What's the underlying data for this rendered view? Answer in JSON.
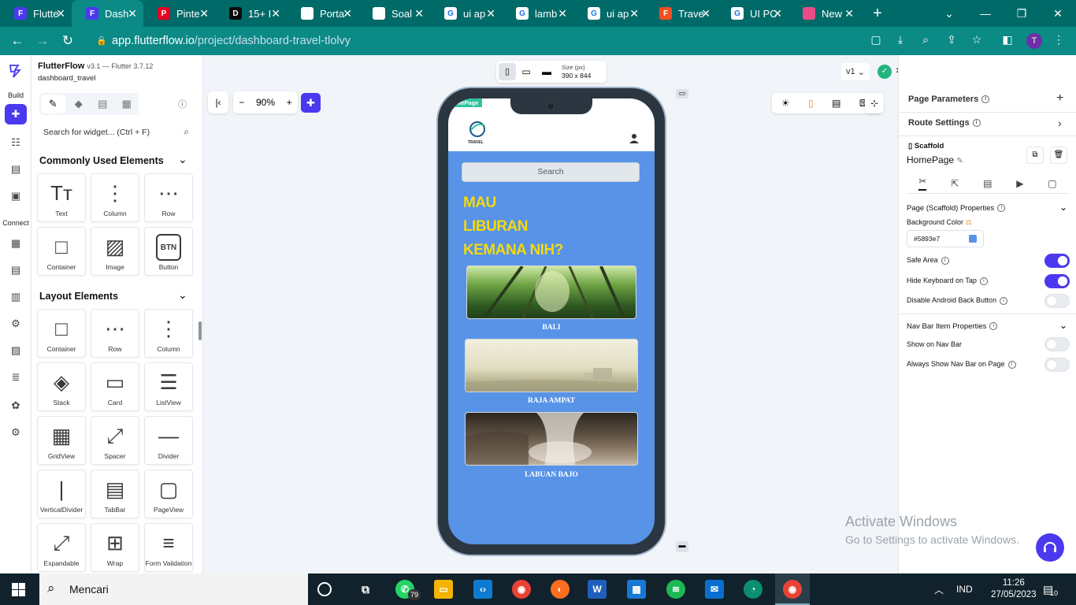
{
  "browser": {
    "tabs": [
      {
        "title": "Flutte",
        "color": "#4b39ef",
        "glyph": "F",
        "active": false
      },
      {
        "title": "Dash",
        "color": "#4b39ef",
        "glyph": "F",
        "active": true
      },
      {
        "title": "Pinte",
        "color": "#e60023",
        "glyph": "P",
        "active": false
      },
      {
        "title": "15+ I",
        "color": "#0a0a0a",
        "glyph": "D",
        "active": false
      },
      {
        "title": "Porta",
        "color": "#ffffff",
        "glyph": "",
        "active": false
      },
      {
        "title": "Soal",
        "color": "#ffffff",
        "glyph": "",
        "active": false
      },
      {
        "title": "ui ap",
        "color": "#ffffff",
        "glyph": "G",
        "active": false
      },
      {
        "title": "lamb",
        "color": "#ffffff",
        "glyph": "G",
        "active": false
      },
      {
        "title": "ui ap",
        "color": "#ffffff",
        "glyph": "G",
        "active": false
      },
      {
        "title": "Trave",
        "color": "#f24e1e",
        "glyph": "F",
        "active": false
      },
      {
        "title": "UI PC",
        "color": "#ffffff",
        "glyph": "G",
        "active": false
      },
      {
        "title": "New",
        "color": "#ea4c89",
        "glyph": "",
        "active": false
      }
    ],
    "url_host": "app.flutterflow.io",
    "url_path": "/project/dashboard-travel-tlolvy",
    "profile_initial": "T"
  },
  "flutterflow": {
    "brand": "FlutterFlow",
    "version": "v3.1 — Flutter 3.7.12",
    "project": "dashboard_travel",
    "rail": {
      "build": "Build",
      "connect": "Connect"
    },
    "search_placeholder": "Search for widget... (Ctrl + F)",
    "zoom": "90%",
    "size_label": "Size (px)",
    "size_value": "390 x 844",
    "version_select": "v1",
    "common_title": "Commonly Used Elements",
    "common": [
      {
        "label": "Text",
        "icon": "text-icon",
        "glyph": "Tт"
      },
      {
        "label": "Column",
        "icon": "column-icon",
        "glyph": "⋮"
      },
      {
        "label": "Row",
        "icon": "row-icon",
        "glyph": "⋯"
      },
      {
        "label": "Container",
        "icon": "container-icon",
        "glyph": "□"
      },
      {
        "label": "Image",
        "icon": "image-icon",
        "glyph": "▨"
      },
      {
        "label": "Button",
        "icon": "button-icon",
        "glyph": "BTN"
      }
    ],
    "layout_title": "Layout Elements",
    "layout": [
      {
        "label": "Container",
        "icon": "container-icon",
        "glyph": "□"
      },
      {
        "label": "Row",
        "icon": "row-icon",
        "glyph": "⋯"
      },
      {
        "label": "Column",
        "icon": "column-icon",
        "glyph": "⋮"
      },
      {
        "label": "Stack",
        "icon": "stack-icon",
        "glyph": "◈"
      },
      {
        "label": "Card",
        "icon": "card-icon",
        "glyph": "▭"
      },
      {
        "label": "ListView",
        "icon": "listview-icon",
        "glyph": "☰"
      },
      {
        "label": "GridView",
        "icon": "gridview-icon",
        "glyph": "▦"
      },
      {
        "label": "Spacer",
        "icon": "spacer-icon",
        "glyph": "⤢"
      },
      {
        "label": "Divider",
        "icon": "divider-icon",
        "glyph": "—"
      },
      {
        "label": "VerticalDivider",
        "icon": "vertical-divider-icon",
        "glyph": "|"
      },
      {
        "label": "TabBar",
        "icon": "tabbar-icon",
        "glyph": "▤"
      },
      {
        "label": "PageView",
        "icon": "pageview-icon",
        "glyph": "▢"
      },
      {
        "label": "Expandable",
        "icon": "expandable-icon",
        "glyph": "⤢"
      },
      {
        "label": "Wrap",
        "icon": "wrap-icon",
        "glyph": "⊞"
      },
      {
        "label": "Form Validation",
        "icon": "form-validation-icon",
        "glyph": "≡"
      }
    ]
  },
  "preview": {
    "page_badge": "omePage",
    "logo_text": "TRAVEL",
    "search": "Search",
    "heading": [
      "MAU",
      "LIBURAN",
      "KEMANA NIH?"
    ],
    "destinations": [
      {
        "name": "BALI",
        "tone": "#3b6b2a"
      },
      {
        "name": "RAJA AMPAT",
        "tone": "#d6d2b4"
      },
      {
        "name": "LABUAN BAJO",
        "tone": "#6a5a48"
      }
    ]
  },
  "properties": {
    "page_parameters": "Page Parameters",
    "route_settings": "Route Settings",
    "widget_type": "Scaffold",
    "page_name": "HomePage",
    "scaffold_section": "Page (Scaffold) Properties",
    "bg_color_label": "Background Color",
    "bg_color_value": "#5893e7",
    "bg_color_hex": "#5893e7",
    "safe_area": "Safe Area",
    "hide_keyboard": "Hide Keyboard on Tap",
    "disable_back": "Disable Android Back Button",
    "nav_section": "Nav Bar Item Properties",
    "show_nav": "Show on Nav Bar",
    "always_show_nav": "Always Show Nav Bar on Page",
    "toggles": {
      "safe_area": true,
      "hide_keyboard": true,
      "disable_back": false,
      "show_nav": false,
      "always_show_nav": false
    }
  },
  "watermark": {
    "line1": "Activate Windows",
    "line2": "Go to Settings to activate Windows."
  },
  "taskbar": {
    "search_placeholder": "Mencari",
    "whatsapp_badge": "79",
    "language": "IND",
    "time": "11:26",
    "date": "27/05/2023",
    "notification_count": "10"
  },
  "colors": {
    "accent": "#4b39ef",
    "chrome": "#006a68",
    "page_bg": "#5893e7",
    "heading": "#f5d90a"
  }
}
